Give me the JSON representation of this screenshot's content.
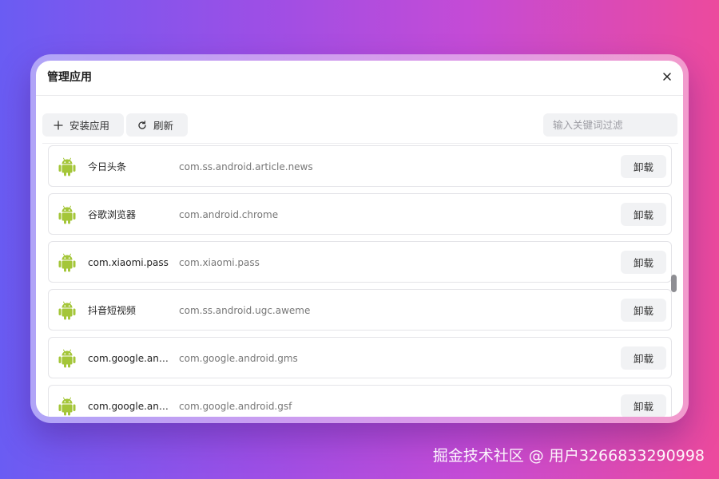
{
  "dialog": {
    "title": "管理应用",
    "close_label": "×"
  },
  "toolbar": {
    "install_label": "安装应用",
    "refresh_label": "刷新",
    "search_placeholder": "输入关键词过滤",
    "search_value": ""
  },
  "apps": [
    {
      "name": "今日头条",
      "package": "com.ss.android.article.news",
      "action": "卸载",
      "icon": "android-icon"
    },
    {
      "name": "谷歌浏览器",
      "package": "com.android.chrome",
      "action": "卸载",
      "icon": "android-icon"
    },
    {
      "name": "com.xiaomi.pass",
      "package": "com.xiaomi.pass",
      "action": "卸载",
      "icon": "android-icon"
    },
    {
      "name": "抖音短视频",
      "package": "com.ss.android.ugc.aweme",
      "action": "卸载",
      "icon": "android-icon"
    },
    {
      "name": "com.google.andr...",
      "package": "com.google.android.gms",
      "action": "卸载",
      "icon": "android-icon"
    },
    {
      "name": "com.google.andr...",
      "package": "com.google.android.gsf",
      "action": "卸载",
      "icon": "android-icon"
    }
  ],
  "watermark": "掘金技术社区 @ 用户3266833290998",
  "colors": {
    "android_green": "#a4c639",
    "button_bg": "#f1f2f4",
    "background_start": "#6a5cf3",
    "background_end": "#ec4a9d"
  }
}
